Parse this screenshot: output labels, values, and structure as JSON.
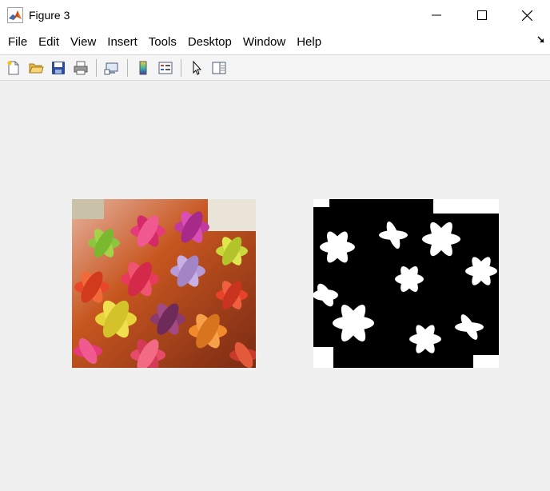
{
  "window": {
    "title": "Figure 3",
    "icon": "matlab-icon",
    "controls": [
      "minimize-icon",
      "maximize-icon",
      "close-icon"
    ]
  },
  "menu": {
    "items": [
      "File",
      "Edit",
      "View",
      "Insert",
      "Tools",
      "Desktop",
      "Window",
      "Help"
    ],
    "dock_icon": "dock-arrow-icon"
  },
  "toolbar": {
    "buttons": [
      "new-figure-icon",
      "open-file-icon",
      "save-icon",
      "print-icon",
      "link-plot-icon",
      "colorbar-icon",
      "legend-icon",
      "edit-plot-pointer-icon",
      "property-inspector-icon"
    ]
  },
  "axes": [
    {
      "content": "original color image of colorful paper flowers"
    },
    {
      "content": "binary black and white thresholded image"
    }
  ],
  "colors": {
    "titlebar_bg": "#ffffff",
    "figure_bg": "#f0f0f0",
    "toolbar_bg": "#f5f5f5"
  }
}
